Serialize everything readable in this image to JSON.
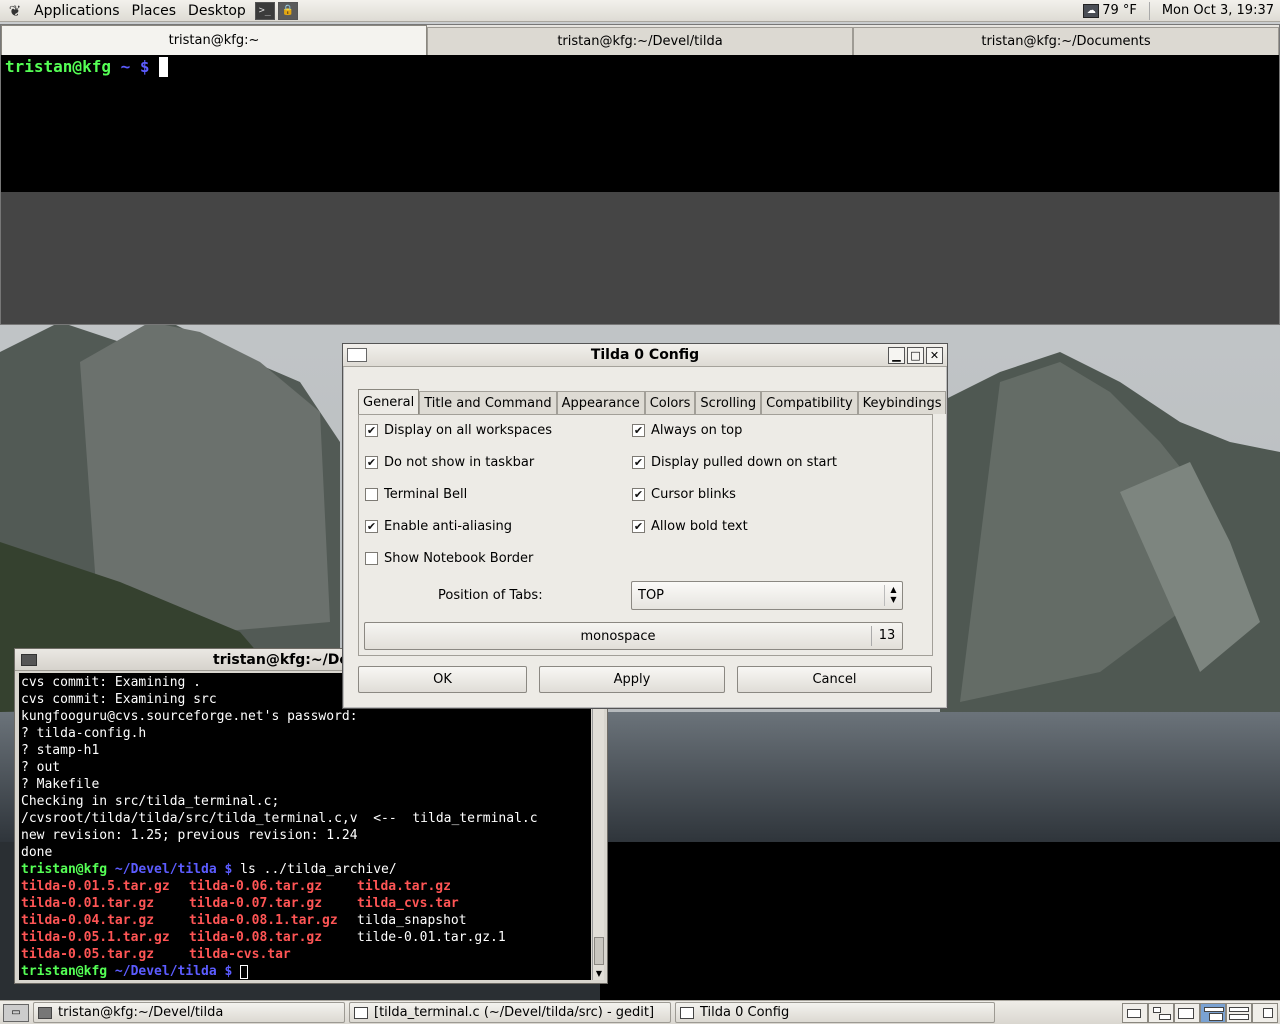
{
  "top_panel": {
    "menus": [
      "Applications",
      "Places",
      "Desktop"
    ],
    "weather": "79 °F",
    "clock": "Mon Oct  3, 19:37"
  },
  "tilda": {
    "tabs": [
      "tristan@kfg:~",
      "tristan@kfg:~/Devel/tilda",
      "tristan@kfg:~/Documents"
    ],
    "prompt_user": "tristan@kfg",
    "prompt_path": " ~ $ "
  },
  "terminal_window": {
    "title": "tristan@kfg:~/Deve",
    "lines": [
      "cvs commit: Examining .",
      "cvs commit: Examining src",
      "kungfooguru@cvs.sourceforge.net's password:",
      "? tilda-config.h",
      "? stamp-h1",
      "? out",
      "? Makefile",
      "Checking in src/tilda_terminal.c;",
      "/cvsroot/tilda/tilda/src/tilda_terminal.c,v  <--  tilda_terminal.c",
      "new revision: 1.25; previous revision: 1.24",
      "done"
    ],
    "prompt_user": "tristan@kfg",
    "prompt_path": " ~/Devel/tilda $ ",
    "command": "ls ../tilda_archive/",
    "ls_rows": [
      [
        {
          "t": "tilda-0.01.5.tar.gz",
          "c": "red"
        },
        {
          "t": "tilda-0.06.tar.gz",
          "c": "red"
        },
        {
          "t": "tilda.tar.gz",
          "c": "red"
        }
      ],
      [
        {
          "t": "tilda-0.01.tar.gz",
          "c": "red"
        },
        {
          "t": "tilda-0.07.tar.gz",
          "c": "red"
        },
        {
          "t": "tilda_cvs.tar",
          "c": "red"
        }
      ],
      [
        {
          "t": "tilda-0.04.tar.gz",
          "c": "red"
        },
        {
          "t": "tilda-0.08.1.tar.gz",
          "c": "red"
        },
        {
          "t": "tilda_snapshot",
          "c": "white"
        }
      ],
      [
        {
          "t": "tilda-0.05.1.tar.gz",
          "c": "red"
        },
        {
          "t": "tilda-0.08.tar.gz",
          "c": "red"
        },
        {
          "t": "tilde-0.01.tar.gz.1",
          "c": "white"
        }
      ],
      [
        {
          "t": "tilda-0.05.tar.gz",
          "c": "red"
        },
        {
          "t": "tilda-cvs.tar",
          "c": "red"
        }
      ]
    ]
  },
  "dialog": {
    "title": "Tilda 0 Config",
    "tabs": [
      "General",
      "Title and Command",
      "Appearance",
      "Colors",
      "Scrolling",
      "Compatibility",
      "Keybindings"
    ],
    "options": {
      "display_all_workspaces": {
        "label": "Display on all workspaces",
        "checked": true
      },
      "always_on_top": {
        "label": "Always on top",
        "checked": true
      },
      "not_in_taskbar": {
        "label": "Do not show in taskbar",
        "checked": true
      },
      "pulled_down_on_start": {
        "label": "Display pulled down on start",
        "checked": true
      },
      "terminal_bell": {
        "label": "Terminal Bell",
        "checked": false
      },
      "cursor_blinks": {
        "label": "Cursor blinks",
        "checked": true
      },
      "anti_aliasing": {
        "label": "Enable anti-aliasing",
        "checked": true
      },
      "bold_text": {
        "label": "Allow bold text",
        "checked": true
      },
      "notebook_border": {
        "label": "Show Notebook Border",
        "checked": false
      }
    },
    "position_of_tabs_label": "Position of Tabs:",
    "position_of_tabs_value": "TOP",
    "font_name": "monospace",
    "font_size": "13",
    "buttons": {
      "ok": "OK",
      "apply": "Apply",
      "cancel": "Cancel"
    }
  },
  "taskbar": {
    "tasks": [
      "tristan@kfg:~/Devel/tilda",
      "[tilda_terminal.c (~/Devel/tilda/src) - gedit]",
      "Tilda 0 Config"
    ]
  },
  "icons": {
    "gnome_menu": "gnome-foot-icon",
    "terminal_launcher": "terminal-launcher-icon",
    "lock_launcher": "lock-screen-icon",
    "weather": "weather-icon",
    "checkbox_checked": "✔"
  }
}
